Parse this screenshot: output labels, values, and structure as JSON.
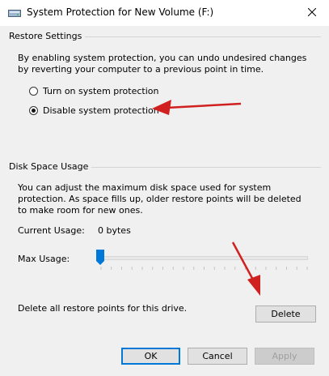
{
  "window": {
    "title": "System Protection for New Volume (F:)"
  },
  "restore_settings": {
    "group_label": "Restore Settings",
    "description": "By enabling system protection, you can undo undesired changes by reverting your computer to a previous point in time.",
    "options": [
      {
        "label": "Turn on system protection",
        "selected": false
      },
      {
        "label": "Disable system protection",
        "selected": true
      }
    ]
  },
  "disk_space": {
    "group_label": "Disk Space Usage",
    "description": "You can adjust the maximum disk space used for system protection. As space fills up, older restore points will be deleted to make room for new ones.",
    "current_usage_label": "Current Usage:",
    "current_usage_value": "0 bytes",
    "max_usage_label": "Max Usage:",
    "max_usage_fraction": 0.0,
    "delete_text": "Delete all restore points for this drive.",
    "delete_label": "Delete"
  },
  "footer": {
    "ok_label": "OK",
    "cancel_label": "Cancel",
    "apply_label": "Apply"
  },
  "colors": {
    "accent": "#0078d7",
    "annotation_arrow": "#d0201f",
    "dialog_bg": "#f0f0f0"
  },
  "icons": {
    "window_icon": "drive-shield-icon",
    "close": "close-icon"
  }
}
